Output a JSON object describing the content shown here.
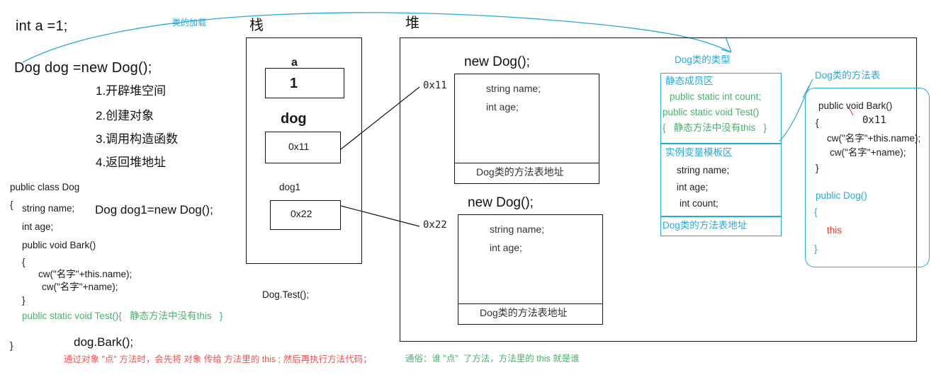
{
  "left_panel": {
    "line_int_a": "int a =1;",
    "line_new_dog": "Dog dog =new Dog();",
    "steps": [
      "1.开辟堆空间",
      "2.创建对象",
      "3.调用构造函数",
      "4.返回堆地址"
    ],
    "class_code": [
      "public class Dog",
      "{",
      "string name;",
      "int age;",
      "public void Bark()",
      "{",
      "cw(\"名字\"+this.name);",
      "cw(\"名字\"+name);",
      "}",
      "}"
    ],
    "static_method_line": "public static void Test(){   静态方法中没有this   }",
    "dog1_decl": "Dog dog1=new Dog();",
    "dog_bark_call": "dog.Bark();"
  },
  "curve": {
    "label": "类的加载"
  },
  "stack": {
    "title": "栈",
    "slots": [
      {
        "name": "a",
        "value": "1"
      },
      {
        "name": "dog",
        "value": "0x11"
      },
      {
        "name": "dog1",
        "value": "0x22"
      }
    ],
    "below_call": "Dog.Test();"
  },
  "heap": {
    "title": "堆",
    "objects": [
      {
        "title": "new Dog();",
        "address": "0x11",
        "fields": [
          "string name;",
          "int age;"
        ],
        "method_table": "Dog类的方法表地址"
      },
      {
        "title": "new Dog();",
        "address": "0x22",
        "fields": [
          "string name;",
          "int age;"
        ],
        "method_table": "Dog类的方法表地址"
      }
    ]
  },
  "class_type": {
    "title": "Dog类的类型",
    "static_area": {
      "heading": "静态成员区",
      "lines": [
        "public static int count;",
        "public static void Test()",
        "{   静态方法中没有this   }"
      ]
    },
    "instance_area": {
      "heading": "实例变量模板区",
      "lines": [
        "string name;",
        "int age;",
        "int count;"
      ]
    },
    "method_table_row": "Dog类的方法表地址"
  },
  "method_table": {
    "title": "Dog类的方法表",
    "bark_signature": "public void Bark()",
    "brace_open": "{",
    "this_addr": "0x11",
    "bark_lines": [
      "cw(\"名字\"+this.name);",
      "cw(\"名字\"+name);"
    ],
    "brace_close": "}",
    "ctor_signature": "public Dog()",
    "ctor_brace_open": "{",
    "ctor_this": "this",
    "ctor_brace_close": "}"
  },
  "footer": {
    "red_note": "通过对象 \"点\" 方法时，会先将 对象 传给 方法里的 this ; 然后再执行方法代码；",
    "green_note": "通俗：谁 \"点\"  了方法，方法里的 this 就是谁"
  },
  "colors": {
    "blue": "#2aa8d8",
    "green": "#4caf6d",
    "red": "#ef5350",
    "dark": "#111111"
  }
}
